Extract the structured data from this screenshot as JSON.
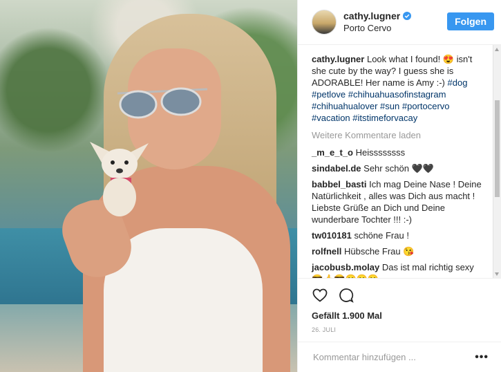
{
  "post": {
    "username": "cathy.lugner",
    "location": "Porto Cervo",
    "follow_label": "Folgen",
    "caption": {
      "username": "cathy.lugner",
      "text_a": "Look what I found! 😍 isn't she cute by the way? I guess she is ADORABLE! Her name is Amy :-)",
      "hashtags": [
        "#dog",
        "#petlove",
        "#chihuahuasofinstagram",
        "#chihuahualover",
        "#sun",
        "#portocervo",
        "#vacation",
        "#itstimeforvacay"
      ]
    },
    "load_more": "Weitere Kommentare laden",
    "comments": [
      {
        "user": "_m_e_t_o",
        "text": "Heissssssss"
      },
      {
        "user": "sindabel.de",
        "text": "Sehr schön 🖤🖤"
      },
      {
        "user": "babbel_basti",
        "text": "Ich mag Deine Nase ! Deine Natürlichkeit , alles was Dich aus macht ! Liebste Grüße an Dich und Deine wunderbare Tochter !!! :-)"
      },
      {
        "user": "tw010181",
        "text": "schöne Frau !"
      },
      {
        "user": "rolfnell",
        "text": "Hübsche Frau 😘"
      },
      {
        "user": "jacobusb.molay",
        "text": "Das ist mal richtig sexy 😎👍😎😁😁😁"
      }
    ],
    "likes": "Gefällt 1.900 Mal",
    "date": "26. JULI",
    "add_comment_placeholder": "Kommentar hinzufügen ...",
    "options_icon": "more-dots",
    "colors": {
      "follow_button": "#3897f0",
      "hashtag": "#003569",
      "muted": "#999999"
    }
  }
}
